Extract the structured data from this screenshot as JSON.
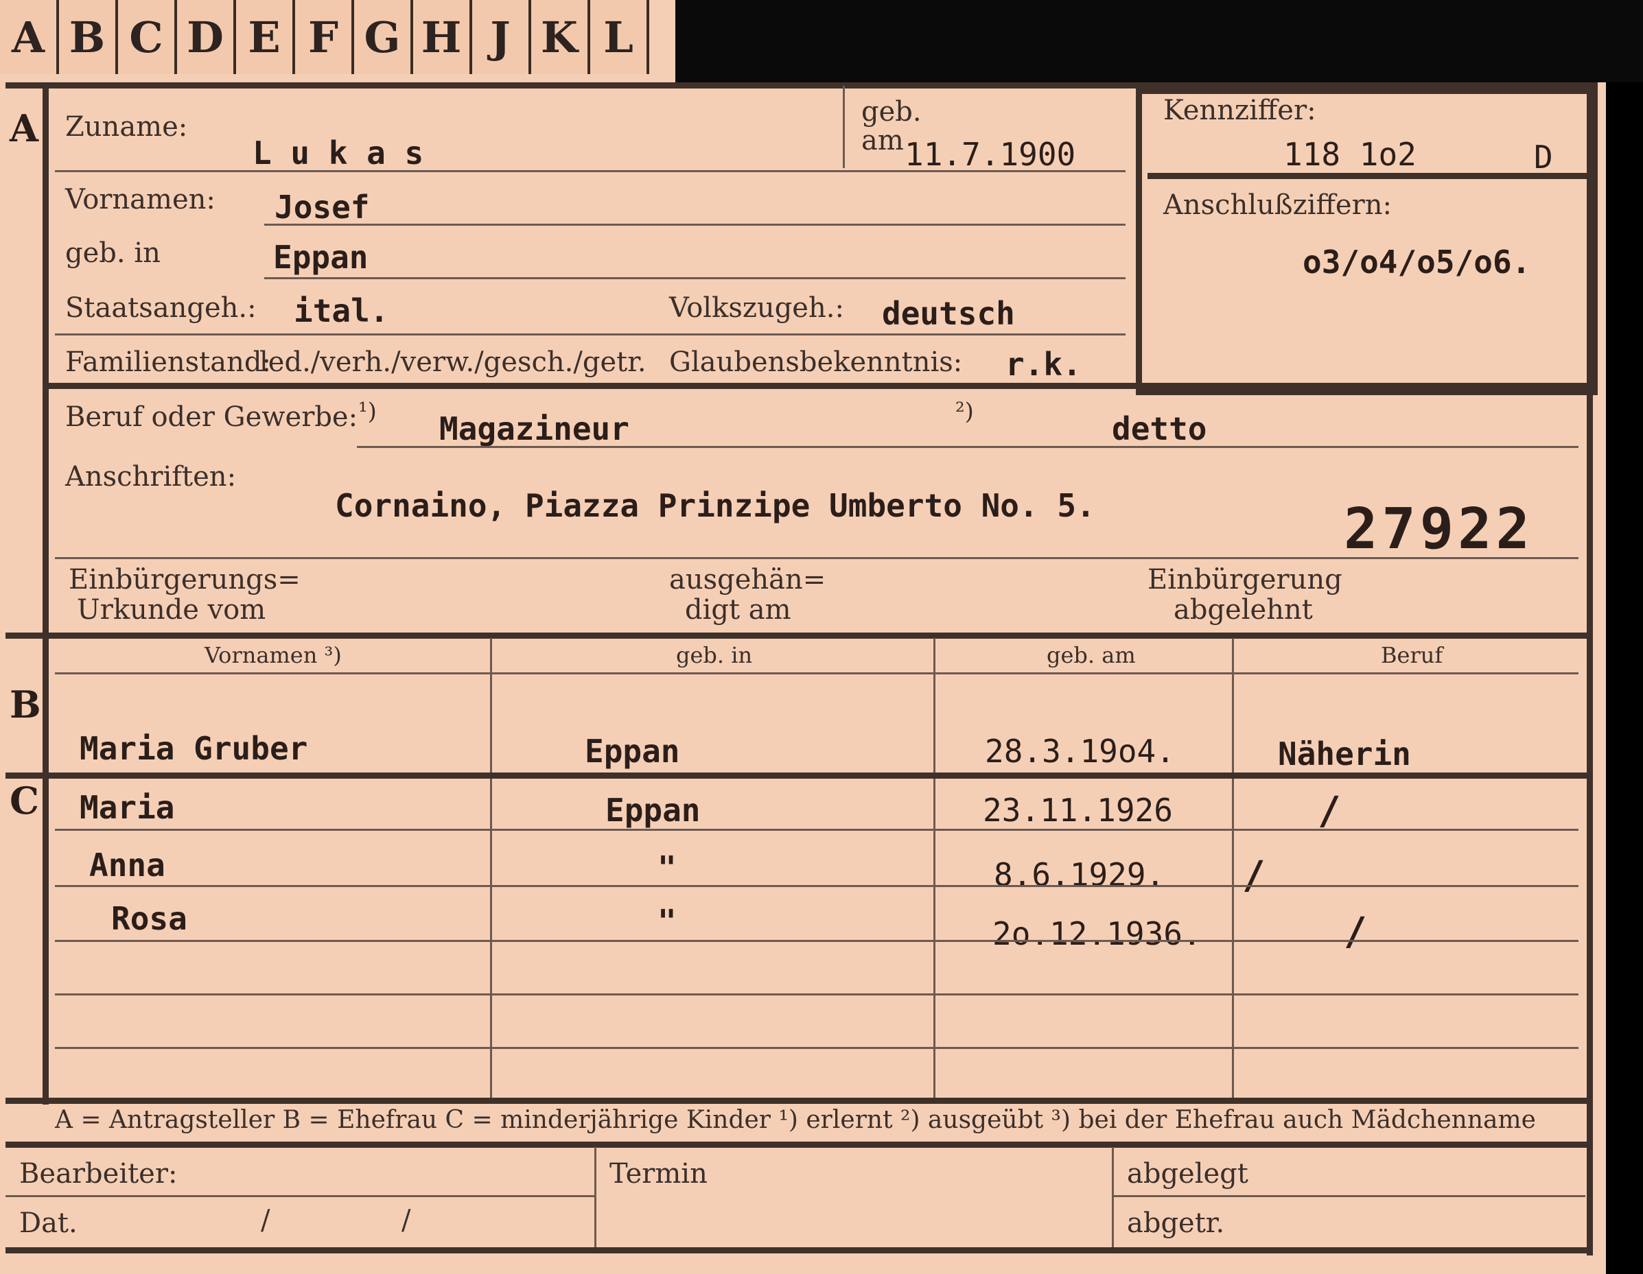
{
  "tabs": [
    "A",
    "B",
    "C",
    "D",
    "E",
    "F",
    "G",
    "H",
    "J",
    "K",
    "L"
  ],
  "sections": {
    "a": "A",
    "b": "B",
    "c": "C"
  },
  "labels": {
    "zuname": "Zuname:",
    "geb": "geb.",
    "am": "am",
    "kennziffer": "Kennziffer:",
    "anschluss": "Anschlußziffern:",
    "vornamen": "Vornamen:",
    "geb_in": "geb. in",
    "staatsangeh": "Staatsangeh.:",
    "volkszugeh": "Volkszugeh.:",
    "familienstand": "Familienstand:",
    "familienstand_options": "led./verh./verw./gesch./getr.",
    "glaubens": "Glaubensbekenntnis:",
    "beruf": "Beruf oder Gewerbe:",
    "beruf_note1": "¹)",
    "beruf_note2": "²)",
    "anschriften": "Anschriften:",
    "einb_urkunde_1": "Einbürgerungs=",
    "einb_urkunde_2": "Urkunde vom",
    "ausgeh_1": "ausgehän=",
    "ausgeh_2": "digt am",
    "einb_abgel_1": "Einbürgerung",
    "einb_abgel_2": "abgelehnt"
  },
  "values": {
    "zuname": "L u k a s",
    "geburtsdatum": "11.7.1900",
    "kennziffer": "118 1o2",
    "kennziffer_suffix": "D",
    "anschluss": "o3/o4/o5/o6.",
    "vornamen": "Josef",
    "geb_in": "Eppan",
    "staatsangeh": "ital.",
    "volkszugeh": "deutsch",
    "glaubens": "r.k.",
    "beruf1": "Magazineur",
    "beruf2": "detto",
    "anschrift": "Cornaino, Piazza Prinzipe Umberto No. 5.",
    "stamp_number": "27922"
  },
  "table": {
    "headers": [
      "Vornamen ³)",
      "geb. in",
      "geb. am",
      "Beruf"
    ],
    "wife": {
      "name": "Maria Gruber",
      "place": "Eppan",
      "date": "28.3.19o4.",
      "job": "Näherin"
    },
    "children": [
      {
        "name": "Maria",
        "place": "Eppan",
        "date": "23.11.1926",
        "job": "/"
      },
      {
        "name": "Anna",
        "place": "\"",
        "date": "8.6.1929.",
        "job": "/"
      },
      {
        "name": "Rosa",
        "place": "\"",
        "date": "2o.12.1936.",
        "job": "/"
      }
    ]
  },
  "legend": "A = Antragsteller   B = Ehefrau   C = minderjährige Kinder   ¹) erlernt   ²) ausgeübt   ³) bei der Ehefrau auch Mädchenname",
  "footer": {
    "bearbeiter": "Bearbeiter:",
    "dat": "Dat.",
    "slash1": "/",
    "slash2": "/",
    "termin": "Termin",
    "abgelegt": "abgelegt",
    "abgetr": "abgetr."
  }
}
